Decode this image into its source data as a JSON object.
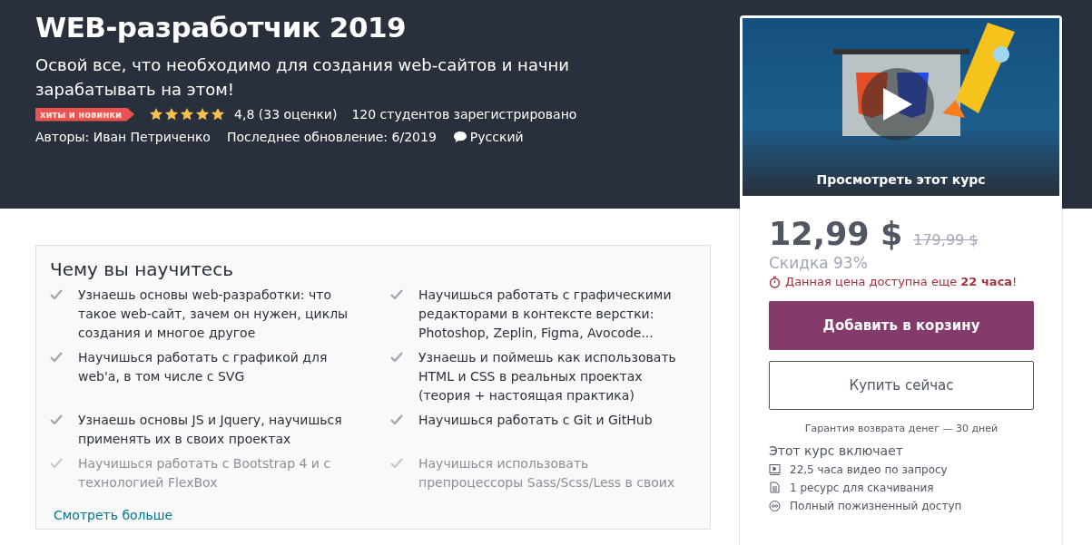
{
  "header": {
    "title": "WEB-разработчик 2019",
    "subtitle": "Освой все, что необходимо для создания web-сайтов и начни зарабатывать на этом!",
    "badge": "хиты и новинки",
    "stars": 5,
    "rating": "4,8 (33 оценки)",
    "students": "120 студентов зарегистрировано",
    "authors": "Авторы: Иван Петриченко",
    "updated": "Последнее обновление: 6/2019",
    "language": "Русский"
  },
  "learn": {
    "title": "Чему вы научитесь",
    "items": [
      {
        "text": "Узнаешь основы web-разработки: что такое web-сайт, зачем он нужен, циклы создания и многое другое",
        "faded": false
      },
      {
        "text": "Научишься работать с графическими редакторами в контексте верстки: Photoshop, Zeplin, Figma, Avocode...",
        "faded": false
      },
      {
        "text": "Научишься работать с графикой для web'a, в том числе с SVG",
        "faded": false
      },
      {
        "text": "Узнаешь и поймешь как использовать HTML и CSS в реальных проектах (теория + настоящая практика)",
        "faded": false
      },
      {
        "text": "Узнаешь основы JS и Jquery, научишься применять их в своих проектах",
        "faded": false
      },
      {
        "text": "Научишься работать с Git и GitHub",
        "faded": false
      },
      {
        "text": "Научишься работать с Bootstrap 4 и с технологией FlexBox",
        "faded": true
      },
      {
        "text": "Научишься использовать препроцессоры Sass/Scss/Less в своих",
        "faded": true
      }
    ],
    "more_link": "Смотреть больше"
  },
  "sidebar": {
    "preview_label": "Просмотреть этот курс",
    "price": "12,99 $",
    "old_price": "179,99 $",
    "discount": "Скидка 93%",
    "deadline": "Данная цена доступна еще **22 часа**!",
    "add_to_cart": "Добавить в корзину",
    "buy_now": "Купить сейчас",
    "guarantee": "Гарантия возврата денег — 30 дней",
    "includes_title": "Этот курс включает",
    "includes": [
      {
        "kind": "video",
        "text": "22,5 часа видео по запросу"
      },
      {
        "kind": "file",
        "text": "1 ресурс для скачивания"
      },
      {
        "kind": "infinity",
        "text": "Полный пожизненный доступ"
      }
    ]
  }
}
